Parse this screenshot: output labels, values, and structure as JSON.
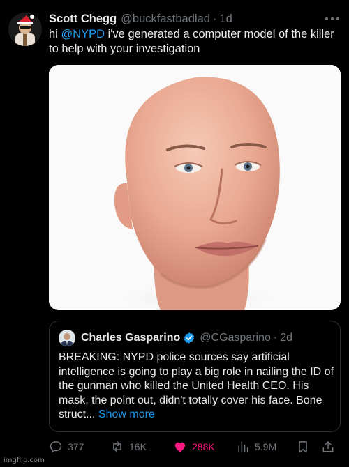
{
  "tweet": {
    "author_name": "Scott Chegg",
    "author_handle": "@buckfastbadlad",
    "separator": "·",
    "time": "1d",
    "text_prefix": "hi ",
    "mention": "@NYPD",
    "text_suffix": " i've generated a computer model of the killer to help with your investigation",
    "more_icon": "more-horizontal-icon",
    "media_icon": "generated-face-image"
  },
  "quote": {
    "author_name": "Charles Gasparino",
    "author_handle": "@CGasparino",
    "separator": "·",
    "time": "2d",
    "verified_icon": "verified-badge-icon",
    "text": "BREAKING: NYPD police sources say artificial intelligence is going to play a big role in nailing the ID of the gunman who killed the United Health CEO. His mask, the point out, didn't totally cover his face. Bone struct...",
    "show_more": "Show more"
  },
  "actions": {
    "replies": "377",
    "retweets": "16K",
    "likes": "288K",
    "views": "5.9M"
  },
  "colors": {
    "background": "#000000",
    "link": "#1d9bf0",
    "like": "#f91880",
    "muted": "#71767b"
  },
  "watermark": "imgflip.com"
}
